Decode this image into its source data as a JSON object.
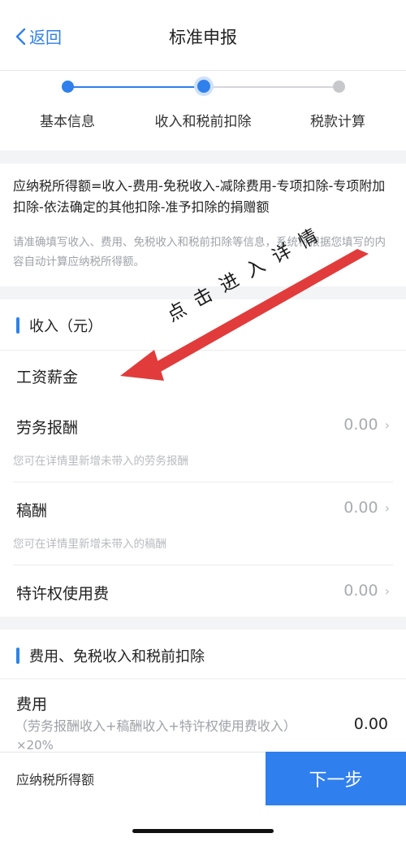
{
  "header": {
    "back_label": "返回",
    "title": "标准申报"
  },
  "steps": [
    {
      "label": "基本信息",
      "state": "done"
    },
    {
      "label": "收入和税前扣除",
      "state": "active"
    },
    {
      "label": "税款计算",
      "state": "pending"
    }
  ],
  "formula": {
    "text": "应纳税所得额=收入-费用-免税收入-减除费用-专项扣除-专项附加扣除-依法确定的其他扣除-准予扣除的捐赠额",
    "hint": "请准确填写收入、费用、免税收入和税前扣除等信息，系统将根据您填写的内容自动计算应纳税所得额。"
  },
  "income": {
    "title": "收入（元）",
    "rows": [
      {
        "label": "工资薪金"
      },
      {
        "label": "劳务报酬",
        "value": "0.00",
        "hint": "您可在详情里新增未带入的劳务报酬"
      },
      {
        "label": "稿酬",
        "value": "0.00",
        "hint": "您可在详情里新增未带入的稿酬"
      },
      {
        "label": "特许权使用费",
        "value": "0.00"
      }
    ]
  },
  "deductions": {
    "title": "费用、免税收入和税前扣除",
    "rows": [
      {
        "label": "费用",
        "formula_line1": "（劳务报酬收入+稿酬收入+特许权使用费收入）",
        "formula_line2": "×20%",
        "value": "0.00"
      }
    ]
  },
  "annotation": {
    "text": "点击进入详情",
    "color": "#e23b3b"
  },
  "bottom": {
    "label": "应纳税所得额",
    "next_label": "下一步"
  },
  "colors": {
    "accent": "#2f7fee",
    "muted": "#a8acb2"
  }
}
